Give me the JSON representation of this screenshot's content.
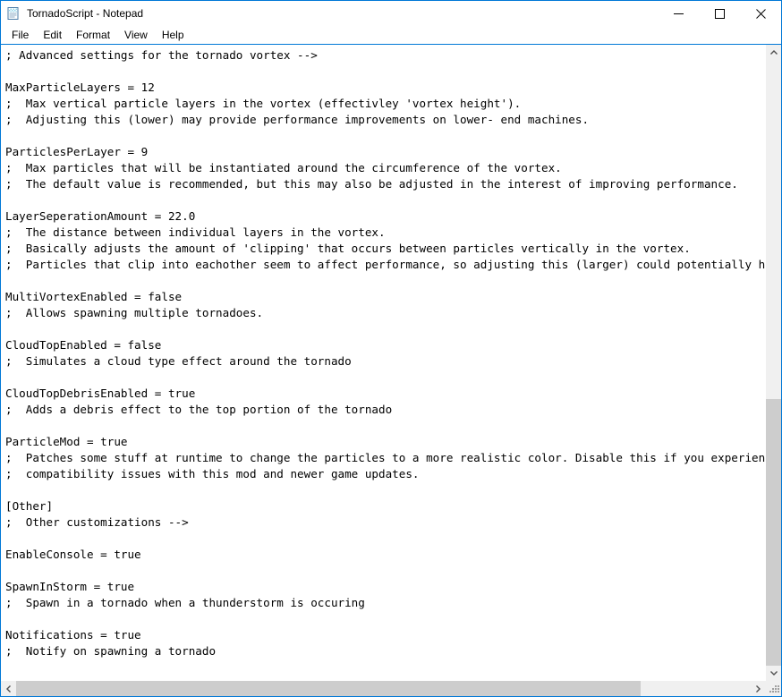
{
  "window": {
    "title": "TornadoScript - Notepad",
    "icon": "notepad-icon"
  },
  "titlebar": {
    "minimize_label": "Minimize",
    "maximize_label": "Maximize",
    "close_label": "Close"
  },
  "menubar": {
    "items": [
      {
        "label": "File"
      },
      {
        "label": "Edit"
      },
      {
        "label": "Format"
      },
      {
        "label": "View"
      },
      {
        "label": "Help"
      }
    ]
  },
  "document": {
    "lines": [
      "; Advanced settings for the tornado vortex -->",
      "",
      "MaxParticleLayers = 12",
      ";  Max vertical particle layers in the vortex (effectivley 'vortex height').",
      ";  Adjusting this (lower) may provide performance improvements on lower- end machines.",
      "",
      "ParticlesPerLayer = 9",
      ";  Max particles that will be instantiated around the circumference of the vortex.",
      ";  The default value is recommended, but this may also be adjusted in the interest of improving performance.",
      "",
      "LayerSeperationAmount = 22.0",
      ";  The distance between individual layers in the vortex.",
      ";  Basically adjusts the amount of 'clipping' that occurs between particles vertically in the vortex.",
      ";  Particles that clip into eachother seem to affect performance, so adjusting this (larger) could potentially help.",
      "",
      "MultiVortexEnabled = false",
      ";  Allows spawning multiple tornadoes.",
      "",
      "CloudTopEnabled = false",
      ";  Simulates a cloud type effect around the tornado",
      "",
      "CloudTopDebrisEnabled = true",
      ";  Adds a debris effect to the top portion of the tornado",
      "",
      "ParticleMod = true",
      ";  Patches some stuff at runtime to change the particles to a more realistic color. Disable this if you experience",
      ";  compatibility issues with this mod and newer game updates.",
      "",
      "[Other]",
      ";  Other customizations -->",
      "",
      "EnableConsole = true",
      "",
      "SpawnInStorm = true",
      ";  Spawn in a tornado when a thunderstorm is occuring",
      "",
      "Notifications = true",
      ";  Notify on spawning a tornado"
    ]
  },
  "scrollbars": {
    "vertical": {
      "up_arrow": "▲",
      "down_arrow": "▼",
      "thumb_top_pct": 56,
      "thumb_height_pct": 44
    },
    "horizontal": {
      "left_arrow": "◀",
      "right_arrow": "▶",
      "thumb_left_pct": 0,
      "thumb_width_pct": 85
    }
  },
  "colors": {
    "accent": "#0078d7",
    "scrollbar_track": "#f0f0f0",
    "scrollbar_thumb": "#cdcdcd",
    "text": "#000000",
    "background": "#ffffff"
  }
}
